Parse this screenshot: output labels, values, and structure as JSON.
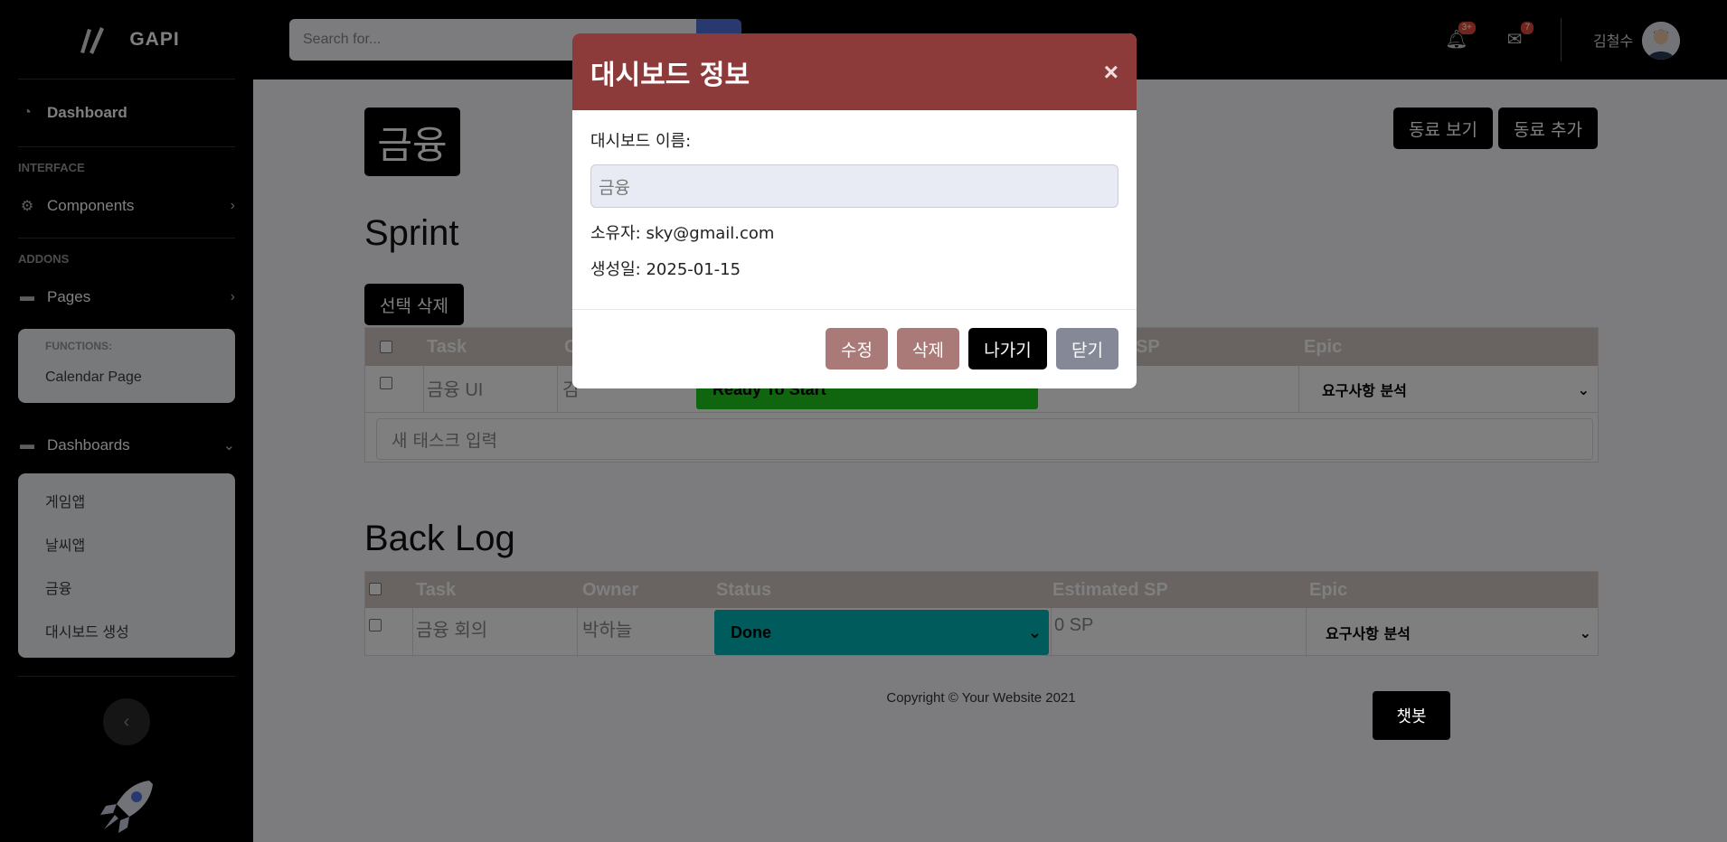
{
  "sidebar": {
    "brand": "GAPI",
    "dashboard_label": "Dashboard",
    "heading_interface": "INTERFACE",
    "components_label": "Components",
    "heading_addons": "ADDONS",
    "pages_label": "Pages",
    "functions_heading": "FUNCTIONS:",
    "calendar_label": "Calendar Page",
    "dashboards_label": "Dashboards",
    "dashboards_items": [
      "게임앱",
      "날씨앱",
      "금융",
      "대시보드 생성"
    ]
  },
  "topbar": {
    "search_placeholder": "Search for...",
    "alerts_badge": "3+",
    "messages_badge": "7",
    "username": "김철수"
  },
  "page": {
    "title": "금융",
    "view_colleagues": "동료 보기",
    "add_colleague": "동료 추가",
    "sprint_title": "Sprint",
    "delete_selected": "선택 삭제",
    "backlog_title": "Back Log",
    "new_task_placeholder": "새 태스크 입력",
    "copyright": "Copyright © Your Website 2021",
    "chatbot": "챗봇"
  },
  "sprint_table": {
    "headers": [
      "Task",
      "C",
      "SP",
      "Epic"
    ],
    "rows": [
      {
        "task": "금융 UI",
        "owner": "김",
        "status": "Ready To Start",
        "sp": "",
        "epic": "요구사항 분석"
      }
    ]
  },
  "backlog_table": {
    "headers": [
      "Task",
      "Owner",
      "Status",
      "Estimated SP",
      "Epic"
    ],
    "rows": [
      {
        "task": "금융 회의",
        "owner": "박하늘",
        "status": "Done",
        "sp": "0 SP",
        "epic": "요구사항 분석"
      }
    ]
  },
  "modal": {
    "title": "대시보드 정보",
    "close": "×",
    "name_label": "대시보드 이름:",
    "name_value": "금융",
    "owner_line": "소유자: sky@gmail.com",
    "created_line": "생성일: 2025-01-15",
    "edit": "수정",
    "delete": "삭제",
    "exit": "나가기",
    "close_btn": "닫기"
  },
  "colors": {
    "modal_header": "#8c3b3a",
    "status_ready": "#1fcc1f",
    "status_done": "#00b8b8",
    "table_header": "#d2c7c3"
  }
}
